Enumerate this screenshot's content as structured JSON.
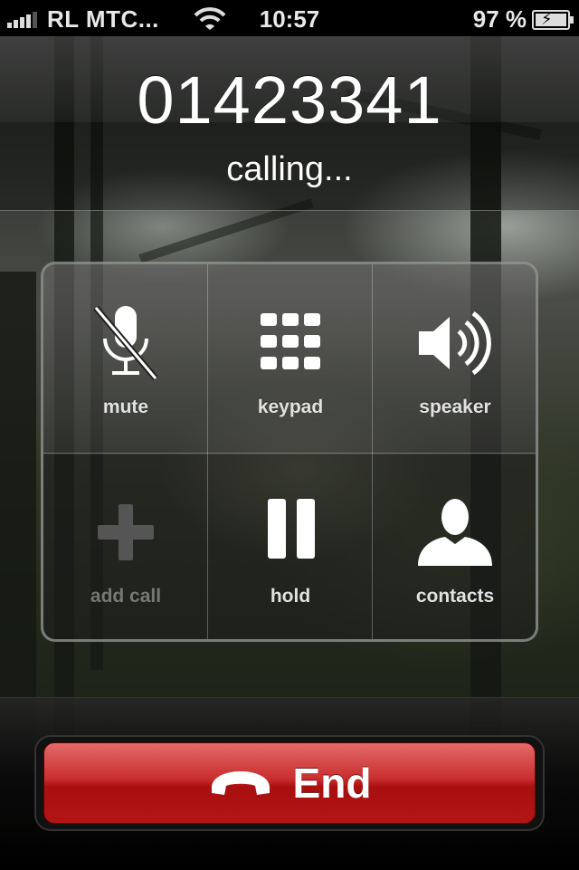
{
  "status_bar": {
    "carrier": "RL MTC...",
    "time": "10:57",
    "battery_percent": "97 %",
    "signal_bars": 4,
    "wifi_icon": "wifi-icon",
    "battery_icon": "battery-charging-icon"
  },
  "call": {
    "number": "01423341",
    "status": "calling..."
  },
  "controls": [
    {
      "label": "mute",
      "icon": "microphone-muted-icon",
      "enabled": true
    },
    {
      "label": "keypad",
      "icon": "keypad-grid-icon",
      "enabled": true
    },
    {
      "label": "speaker",
      "icon": "speaker-icon",
      "enabled": true
    },
    {
      "label": "add call",
      "icon": "plus-icon",
      "enabled": false
    },
    {
      "label": "hold",
      "icon": "pause-icon",
      "enabled": true
    },
    {
      "label": "contacts",
      "icon": "person-silhouette-icon",
      "enabled": true
    }
  ],
  "end_button": {
    "label": "End",
    "icon": "hang-up-phone-icon",
    "color": "#c0201f"
  }
}
